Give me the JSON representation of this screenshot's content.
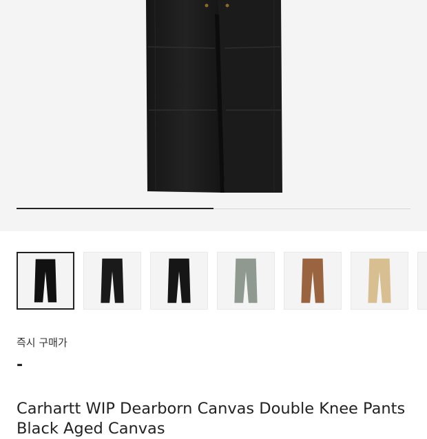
{
  "gallery": {
    "progress": 0.5,
    "thumbnails": [
      {
        "name": "black",
        "color": "#111111",
        "selected": true
      },
      {
        "name": "black-2",
        "color": "#1a1a1a",
        "selected": false
      },
      {
        "name": "black-3",
        "color": "#161616",
        "selected": false
      },
      {
        "name": "grey",
        "color": "#8f9990",
        "selected": false
      },
      {
        "name": "brown",
        "color": "#9a6440",
        "selected": false
      },
      {
        "name": "beige",
        "color": "#d8bf92",
        "selected": false
      },
      {
        "name": "partial",
        "color": "#f0f0f0",
        "selected": false
      }
    ]
  },
  "price": {
    "label": "즉시 구매가",
    "value": "-"
  },
  "product": {
    "title": "Carhartt WIP Dearborn Canvas Double Knee Pants",
    "subtitle": "Black Aged Canvas"
  }
}
